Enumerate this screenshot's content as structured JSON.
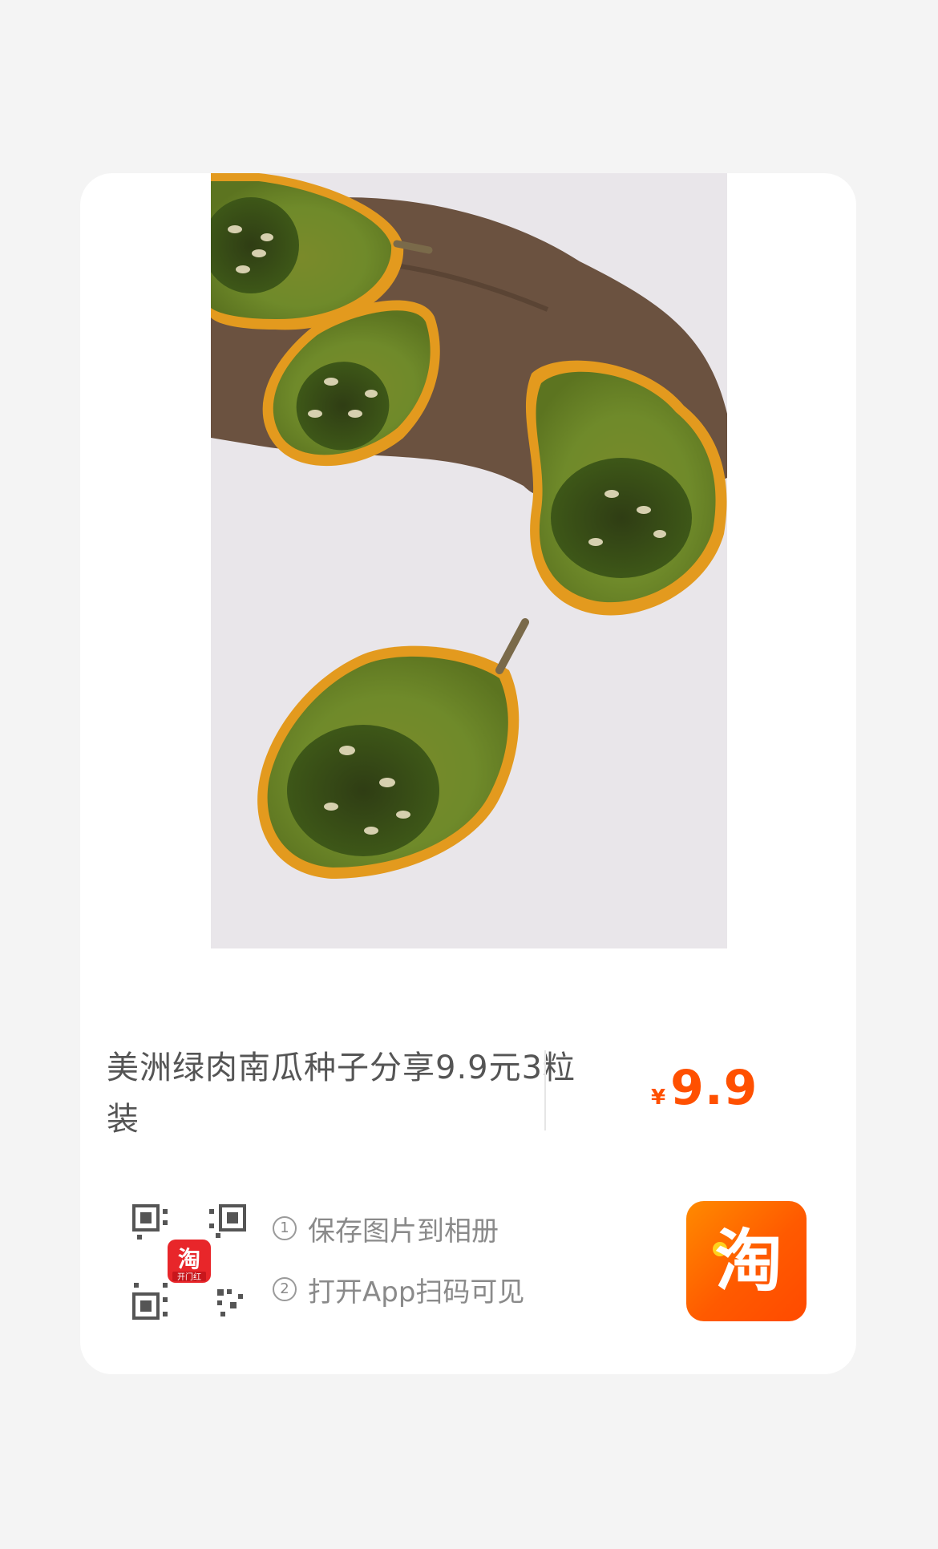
{
  "product": {
    "title": "美洲绿肉南瓜种子分享9.9元3粒装",
    "price_symbol": "¥",
    "price": "9.9"
  },
  "qr_badge": {
    "icon": "taobao-app-icon",
    "label": "淘",
    "sub_label": "开门红"
  },
  "steps": [
    {
      "num": "1",
      "text": "保存图片到相册"
    },
    {
      "num": "2",
      "text": "打开App扫码可见"
    }
  ],
  "app_logo": {
    "icon": "taobao-logo-icon",
    "text": "淘"
  },
  "colors": {
    "accent": "#ff5000",
    "background": "#f4f4f4",
    "card": "#ffffff"
  }
}
